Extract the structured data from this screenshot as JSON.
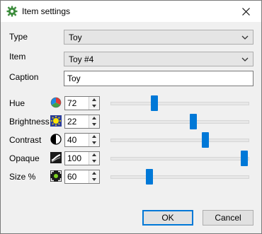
{
  "window": {
    "title": "Item settings",
    "app_icon": "gear-icon",
    "close_icon": "close-icon"
  },
  "form": {
    "type": {
      "label": "Type",
      "value": "Toy"
    },
    "item": {
      "label": "Item",
      "value": "Toy #4"
    },
    "caption": {
      "label": "Caption",
      "value": "Toy"
    }
  },
  "adjustments": [
    {
      "key": "hue",
      "label": "Hue",
      "value": "72",
      "icon": "color-wheel-icon",
      "level": 0.31
    },
    {
      "key": "brightness",
      "label": "Brightness",
      "value": "22",
      "icon": "brightness-icon",
      "level": 0.61
    },
    {
      "key": "contrast",
      "label": "Contrast",
      "value": "40",
      "icon": "contrast-icon",
      "level": 0.7
    },
    {
      "key": "opaque",
      "label": "Opaque",
      "value": "100",
      "icon": "opacity-icon",
      "level": 1.0
    },
    {
      "key": "size",
      "label": "Size %",
      "value": "60",
      "icon": "resize-icon",
      "level": 0.27
    }
  ],
  "buttons": {
    "ok": "OK",
    "cancel": "Cancel"
  },
  "colors": {
    "accent": "#0078d7"
  }
}
